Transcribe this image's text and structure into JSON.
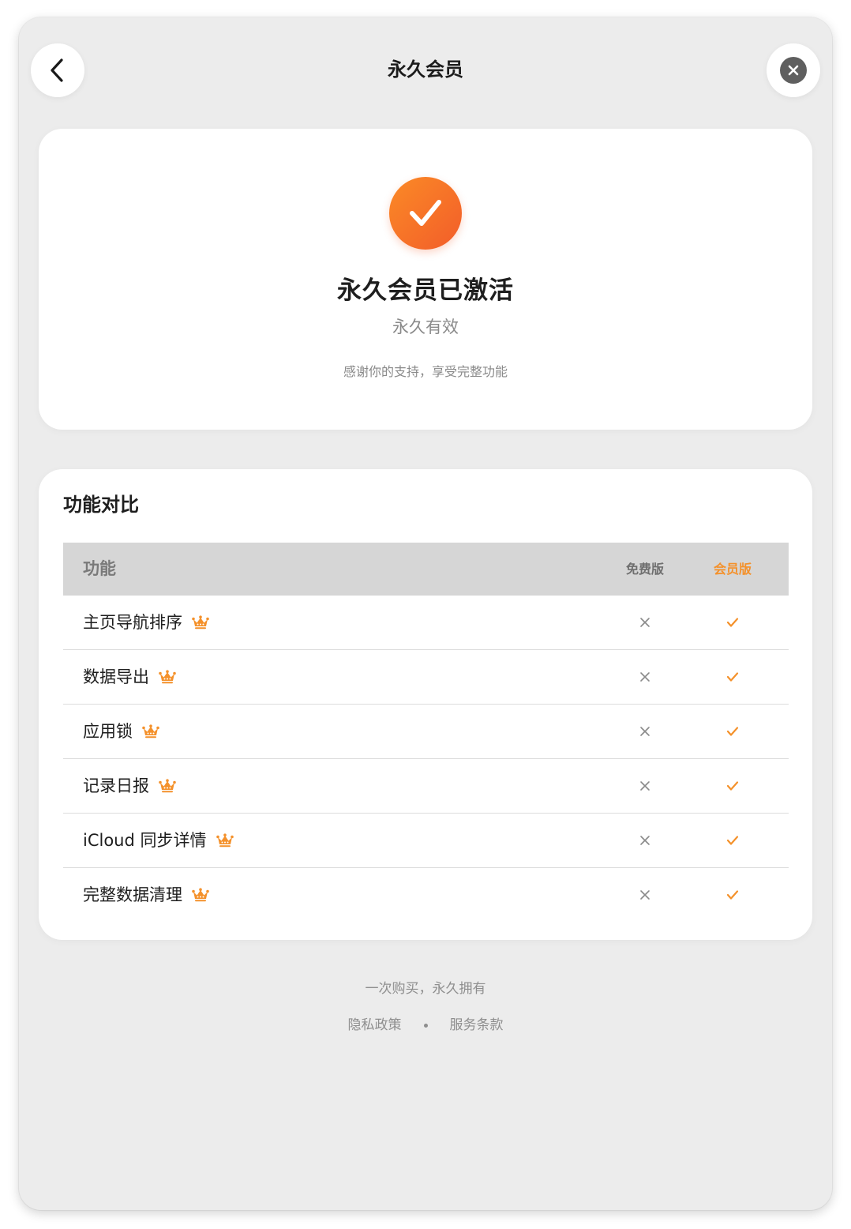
{
  "header": {
    "title": "永久会员",
    "back_icon": "chevron-left-icon",
    "close_icon": "close-circle-icon"
  },
  "status_card": {
    "title": "永久会员已激活",
    "subtitle": "永久有效",
    "note": "感谢你的支持，享受完整功能",
    "icon": "checkmark-badge-icon",
    "accent_color": "#F56B2A"
  },
  "comparison": {
    "title": "功能对比",
    "columns": {
      "feature": "功能",
      "free": "免费版",
      "member": "会员版"
    },
    "rows": [
      {
        "label": "主页导航排序",
        "free": "×",
        "member": "✓"
      },
      {
        "label": "数据导出",
        "free": "×",
        "member": "✓"
      },
      {
        "label": "应用锁",
        "free": "×",
        "member": "✓"
      },
      {
        "label": "记录日报",
        "free": "×",
        "member": "✓"
      },
      {
        "label": "iCloud 同步详情",
        "free": "×",
        "member": "✓"
      },
      {
        "label": "完整数据清理",
        "free": "×",
        "member": "✓"
      }
    ],
    "member_color": "#F4912B"
  },
  "footer": {
    "tagline": "一次购买，永久拥有",
    "privacy_link": "隐私政策",
    "terms_link": "服务条款"
  }
}
